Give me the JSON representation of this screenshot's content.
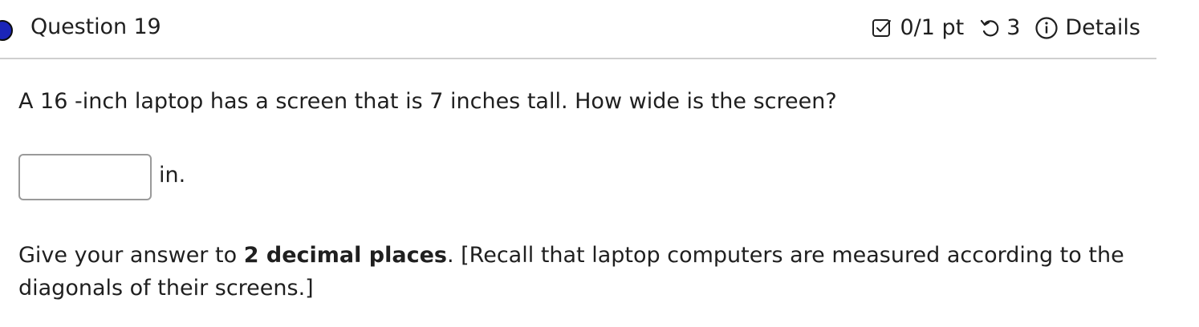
{
  "header": {
    "question_title": "Question 19",
    "points": "0/1 pt",
    "attempts": "3",
    "details_label": "Details",
    "status_color": "#1b25b8"
  },
  "icons": {
    "points": "checkbox-edit-icon",
    "attempts": "undo-retry-icon",
    "details": "info-circle-icon"
  },
  "question": {
    "text": "A 16 -inch laptop has a screen that is 7 inches tall. How wide is the screen?"
  },
  "answer": {
    "value": "",
    "unit": "in."
  },
  "instructions": {
    "prefix": "Give your answer to ",
    "bold": "2 decimal places",
    "suffix": ". [Recall that laptop computers are measured according to the diagonals of their screens.]"
  }
}
